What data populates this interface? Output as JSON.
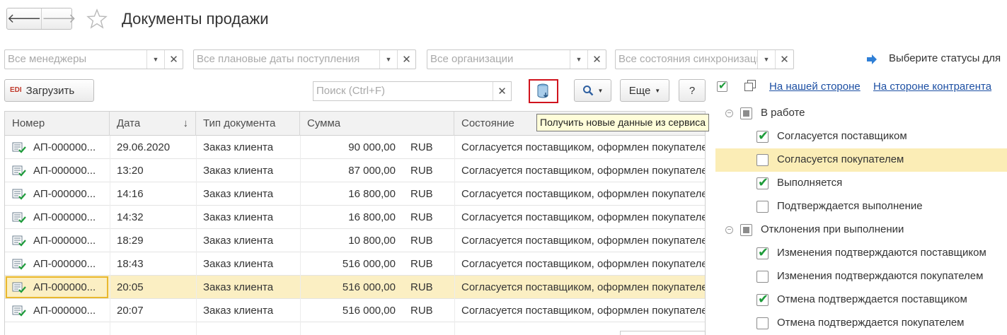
{
  "header": {
    "title": "Документы продажи",
    "back": "🡐",
    "forward": "🡒",
    "star_icon": "star-icon"
  },
  "filters": [
    {
      "placeholder": "Все менеджеры"
    },
    {
      "placeholder": "Все плановые даты поступления"
    },
    {
      "placeholder": "Все организации"
    },
    {
      "placeholder": "Все состояния синхронизации"
    }
  ],
  "toolbar": {
    "load_label": "Загрузить",
    "edi_label": "EDI",
    "search_placeholder": "Поиск (Ctrl+F)",
    "more_label": "Еще",
    "help_label": "?",
    "tooltip": "Получить новые данные из сервиса"
  },
  "table": {
    "columns": [
      "Номер",
      "Дата",
      "Тип документа",
      "Сумма",
      "Состояние"
    ],
    "sort_indicator": "↓",
    "rows": [
      {
        "number": "АП-000000...",
        "date": "29.06.2020",
        "type": "Заказ клиента",
        "sum": "90 000,00",
        "currency": "RUB",
        "status": "Согласуется поставщиком, оформлен покупателем"
      },
      {
        "number": "АП-000000...",
        "date": "13:20",
        "type": "Заказ клиента",
        "sum": "87 000,00",
        "currency": "RUB",
        "status": "Согласуется поставщиком, оформлен покупателем"
      },
      {
        "number": "АП-000000...",
        "date": "14:16",
        "type": "Заказ клиента",
        "sum": "16 800,00",
        "currency": "RUB",
        "status": "Согласуется поставщиком, оформлен покупателем"
      },
      {
        "number": "АП-000000...",
        "date": "14:32",
        "type": "Заказ клиента",
        "sum": "16 800,00",
        "currency": "RUB",
        "status": "Согласуется поставщиком, оформлен покупателем"
      },
      {
        "number": "АП-000000...",
        "date": "18:29",
        "type": "Заказ клиента",
        "sum": "10 800,00",
        "currency": "RUB",
        "status": "Согласуется поставщиком, оформлен покупателем"
      },
      {
        "number": "АП-000000...",
        "date": "18:43",
        "type": "Заказ клиента",
        "sum": "516 000,00",
        "currency": "RUB",
        "status": "Согласуется поставщиком, оформлен покупателем"
      },
      {
        "number": "АП-000000...",
        "date": "20:05",
        "type": "Заказ клиента",
        "sum": "516 000,00",
        "currency": "RUB",
        "status": "Согласуется поставщиком, оформлен покупателем",
        "selected": true
      },
      {
        "number": "АП-000000...",
        "date": "20:07",
        "type": "Заказ клиента",
        "sum": "516 000,00",
        "currency": "RUB",
        "status": "Согласуется поставщиком, оформлен покупателем"
      }
    ]
  },
  "status_panel": {
    "title": "Выберите статусы для",
    "link_ours": "На нашей стороне",
    "link_partner": "На стороне контрагента",
    "groups": [
      {
        "label": "В работе",
        "items": [
          {
            "label": "Согласуется поставщиком",
            "checked": true
          },
          {
            "label": "Согласуется покупателем",
            "checked": false,
            "highlighted": true
          },
          {
            "label": "Выполняется",
            "checked": true
          },
          {
            "label": "Подтверждается выполнение",
            "checked": false
          }
        ]
      },
      {
        "label": "Отклонения при выполнении",
        "items": [
          {
            "label": "Изменения подтверждаются поставщиком",
            "checked": true
          },
          {
            "label": "Изменения подтверждаются покупателем",
            "checked": false
          },
          {
            "label": "Отмена подтверждается поставщиком",
            "checked": true
          },
          {
            "label": "Отмена подтверждается покупателем",
            "checked": false
          }
        ]
      }
    ]
  },
  "colors": {
    "accent_link": "#1c4fa3",
    "selection": "#fbefc3",
    "check": "#1e9b3a",
    "highlight_border": "#d0131d"
  }
}
